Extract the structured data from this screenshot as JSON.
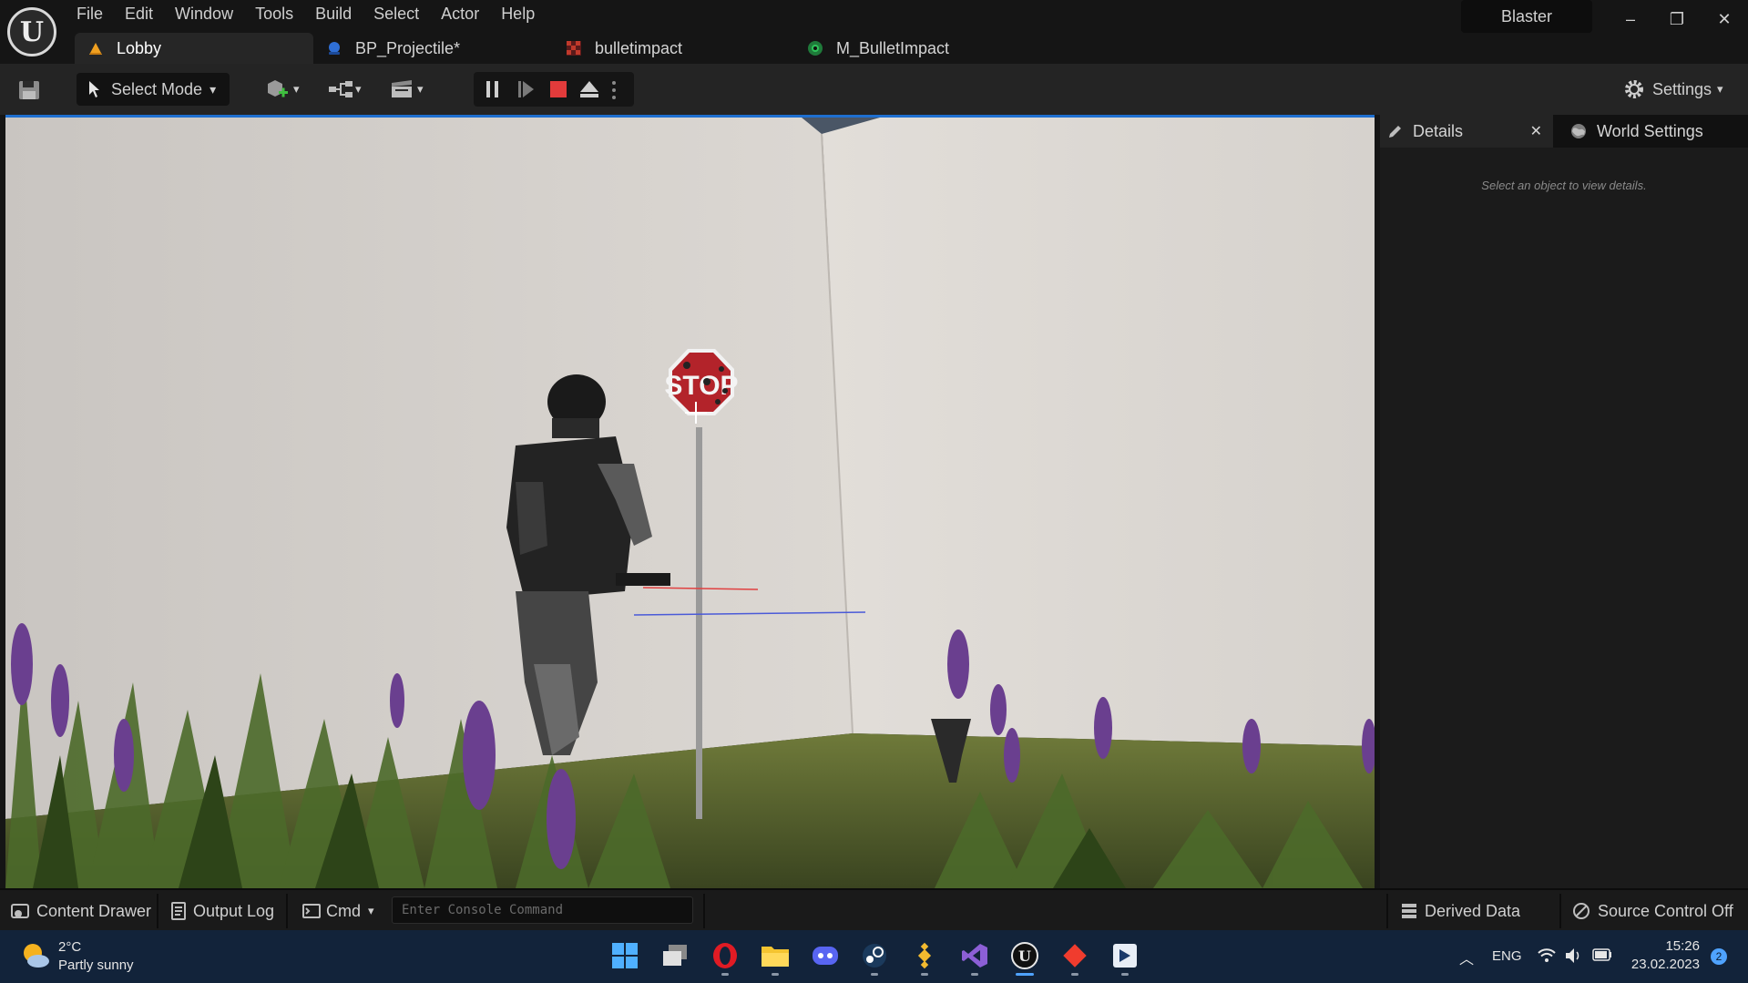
{
  "menu": {
    "items": [
      "File",
      "Edit",
      "Window",
      "Tools",
      "Build",
      "Select",
      "Actor",
      "Help"
    ]
  },
  "project_name": "Blaster",
  "window_controls": {
    "minimize": "–",
    "restore": "❐",
    "close": "✕"
  },
  "tabs": [
    {
      "label": "Lobby",
      "icon": "level-icon",
      "active": true
    },
    {
      "label": "BP_Projectile*",
      "icon": "blueprint-icon",
      "active": false
    },
    {
      "label": "bulletimpact",
      "icon": "texture-icon",
      "active": false
    },
    {
      "label": "M_BulletImpact",
      "icon": "material-icon",
      "active": false
    }
  ],
  "toolbar": {
    "select_mode_label": "Select Mode",
    "settings_label": "Settings"
  },
  "viewport": {
    "sign_text": "STOP"
  },
  "details_panel": {
    "details_tab_label": "Details",
    "world_settings_tab_label": "World Settings",
    "hint": "Select an object to view details."
  },
  "statusbar": {
    "content_drawer_label": "Content Drawer",
    "output_log_label": "Output Log",
    "cmd_label": "Cmd",
    "console_placeholder": "Enter Console Command",
    "derived_data_label": "Derived Data",
    "source_control_label": "Source Control Off"
  },
  "taskbar": {
    "weather_temp": "2°C",
    "weather_desc": "Partly sunny",
    "language": "ENG",
    "time": "15:26",
    "date": "23.02.2023",
    "notification_count": "2",
    "apps": [
      "windows-start-icon",
      "task-view-icon",
      "opera-icon",
      "file-explorer-icon",
      "discord-icon",
      "steam-icon",
      "binance-icon",
      "visual-studio-icon",
      "unreal-engine-icon",
      "git-icon",
      "app-icon"
    ]
  },
  "colors": {
    "accent": "#1e6fd0",
    "stop_sign": "#b3232a",
    "stop_button": "#e23b3b"
  }
}
